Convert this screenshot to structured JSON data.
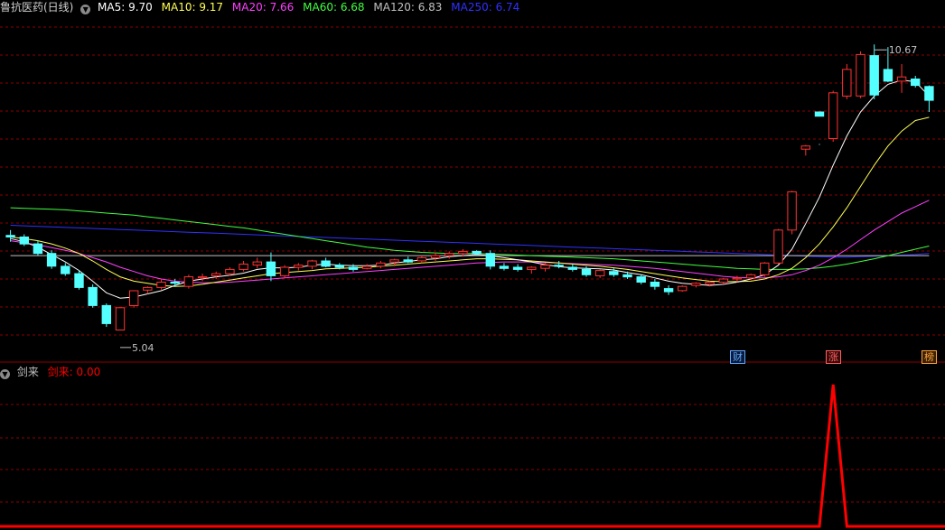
{
  "header": {
    "stock_name": "鲁抗医药(日线)",
    "ma": [
      {
        "label": "MA5: 9.70",
        "color": "#ffffff"
      },
      {
        "label": "MA10: 9.17",
        "color": "#ffff55"
      },
      {
        "label": "MA20: 7.66",
        "color": "#ff40ff"
      },
      {
        "label": "MA60: 6.68",
        "color": "#40ff40"
      },
      {
        "label": "MA120: 6.83",
        "color": "#c0c0c0"
      },
      {
        "label": "MA250: 6.74",
        "color": "#3030ff"
      }
    ]
  },
  "indicator": {
    "name": "剑来",
    "value_label": "剑来: 0.00",
    "color": "#ff0000"
  },
  "annotations": {
    "high": "10.67",
    "low": "5.04"
  },
  "badges": [
    {
      "text": "财",
      "color": "#5fa8ff",
      "bg": "#0a1a3a",
      "day": 53
    },
    {
      "text": "涨",
      "color": "#ff6060",
      "bg": "#3a0a0a",
      "day": 60
    },
    {
      "text": "榜",
      "color": "#ffa040",
      "bg": "#3a2200",
      "day": 67
    }
  ],
  "colors": {
    "up": "#ff3232",
    "down": "#54ffff",
    "grid": "#8b0000",
    "axis": "#8b0000"
  },
  "chart_data": [
    {
      "type": "candlestick",
      "title": "",
      "candles_ohlc": [
        [
          7.08,
          7.18,
          6.96,
          7.05
        ],
        [
          7.05,
          7.1,
          6.88,
          6.92
        ],
        [
          6.92,
          6.98,
          6.7,
          6.74
        ],
        [
          6.74,
          6.8,
          6.45,
          6.5
        ],
        [
          6.5,
          6.56,
          6.32,
          6.36
        ],
        [
          6.36,
          6.42,
          6.06,
          6.1
        ],
        [
          6.1,
          6.16,
          5.72,
          5.76
        ],
        [
          5.76,
          5.8,
          5.36,
          5.42
        ],
        [
          5.3,
          5.04,
          5.04,
          5.72
        ],
        [
          5.76,
          6.05,
          5.72,
          6.04
        ],
        [
          6.05,
          6.12,
          5.98,
          6.1
        ],
        [
          6.1,
          6.26,
          6.06,
          6.2
        ],
        [
          6.2,
          6.26,
          6.12,
          6.18
        ],
        [
          6.12,
          6.34,
          6.08,
          6.3
        ],
        [
          6.28,
          6.36,
          6.22,
          6.3
        ],
        [
          6.32,
          6.4,
          6.26,
          6.36
        ],
        [
          6.36,
          6.48,
          6.32,
          6.44
        ],
        [
          6.44,
          6.6,
          6.4,
          6.54
        ],
        [
          6.52,
          6.66,
          6.46,
          6.58
        ],
        [
          6.58,
          6.76,
          6.22,
          6.32
        ],
        [
          6.32,
          6.52,
          6.28,
          6.48
        ],
        [
          6.48,
          6.56,
          6.42,
          6.52
        ],
        [
          6.5,
          6.62,
          6.44,
          6.6
        ],
        [
          6.6,
          6.66,
          6.48,
          6.5
        ],
        [
          6.52,
          6.56,
          6.44,
          6.48
        ],
        [
          6.48,
          6.54,
          6.4,
          6.44
        ],
        [
          6.46,
          6.54,
          6.44,
          6.5
        ],
        [
          6.5,
          6.6,
          6.46,
          6.56
        ],
        [
          6.58,
          6.64,
          6.5,
          6.62
        ],
        [
          6.62,
          6.68,
          6.56,
          6.58
        ],
        [
          6.6,
          6.7,
          6.56,
          6.66
        ],
        [
          6.66,
          6.76,
          6.6,
          6.7
        ],
        [
          6.7,
          6.78,
          6.64,
          6.74
        ],
        [
          6.74,
          6.82,
          6.68,
          6.78
        ],
        [
          6.78,
          6.8,
          6.7,
          6.74
        ],
        [
          6.74,
          6.8,
          6.44,
          6.5
        ],
        [
          6.5,
          6.56,
          6.42,
          6.46
        ],
        [
          6.48,
          6.54,
          6.4,
          6.44
        ],
        [
          6.44,
          6.5,
          6.36,
          6.48
        ],
        [
          6.46,
          6.56,
          6.4,
          6.52
        ],
        [
          6.52,
          6.6,
          6.46,
          6.5
        ],
        [
          6.48,
          6.54,
          6.4,
          6.44
        ],
        [
          6.44,
          6.5,
          6.3,
          6.34
        ],
        [
          6.32,
          6.44,
          6.28,
          6.42
        ],
        [
          6.4,
          6.46,
          6.3,
          6.34
        ],
        [
          6.34,
          6.4,
          6.26,
          6.3
        ],
        [
          6.3,
          6.34,
          6.16,
          6.2
        ],
        [
          6.2,
          6.26,
          6.06,
          6.12
        ],
        [
          6.08,
          6.14,
          5.96,
          6.02
        ],
        [
          6.04,
          6.14,
          6.02,
          6.12
        ],
        [
          6.14,
          6.2,
          6.1,
          6.18
        ],
        [
          6.16,
          6.22,
          6.12,
          6.2
        ],
        [
          6.2,
          6.28,
          6.16,
          6.26
        ],
        [
          6.26,
          6.32,
          6.2,
          6.28
        ],
        [
          6.28,
          6.36,
          6.24,
          6.34
        ],
        [
          6.34,
          6.58,
          6.3,
          6.56
        ],
        [
          6.56,
          7.2,
          6.54,
          7.18
        ],
        [
          7.18,
          7.92,
          7.1,
          7.9
        ],
        [
          8.7,
          8.78,
          8.58,
          8.76
        ],
        [
          9.4,
          8.78,
          8.8,
          9.32
        ],
        [
          8.9,
          9.8,
          8.84,
          9.76
        ],
        [
          9.7,
          10.3,
          9.64,
          10.2
        ],
        [
          9.7,
          10.54,
          9.66,
          10.48
        ],
        [
          10.46,
          10.67,
          9.64,
          9.72
        ],
        [
          10.2,
          10.62,
          9.96,
          9.98
        ],
        [
          9.98,
          10.3,
          9.76,
          10.06
        ],
        [
          10.02,
          10.08,
          9.86,
          9.9
        ],
        [
          9.88,
          9.9,
          9.4,
          9.62
        ]
      ],
      "ma5": [
        7.02,
        6.96,
        6.86,
        6.72,
        6.58,
        6.42,
        6.22,
        6.0,
        5.9,
        5.92,
        5.98,
        6.04,
        6.14,
        6.22,
        6.26,
        6.3,
        6.33,
        6.37,
        6.44,
        6.47,
        6.47,
        6.48,
        6.52,
        6.54,
        6.52,
        6.51,
        6.51,
        6.52,
        6.56,
        6.59,
        6.62,
        6.64,
        6.68,
        6.7,
        6.72,
        6.7,
        6.66,
        6.62,
        6.58,
        6.53,
        6.49,
        6.47,
        6.46,
        6.45,
        6.43,
        6.38,
        6.34,
        6.28,
        6.22,
        6.18,
        6.16,
        6.14,
        6.16,
        6.2,
        6.26,
        6.34,
        6.52,
        6.82,
        7.3,
        7.8,
        8.4,
        8.95,
        9.4,
        9.7,
        9.92,
        10.0,
        9.97,
        9.7
      ],
      "ma10": [
        7.05,
        7.02,
        6.98,
        6.92,
        6.84,
        6.74,
        6.6,
        6.44,
        6.3,
        6.22,
        6.18,
        6.14,
        6.12,
        6.13,
        6.16,
        6.2,
        6.24,
        6.28,
        6.32,
        6.36,
        6.38,
        6.4,
        6.42,
        6.45,
        6.46,
        6.47,
        6.48,
        6.5,
        6.52,
        6.54,
        6.56,
        6.58,
        6.6,
        6.62,
        6.64,
        6.64,
        6.63,
        6.62,
        6.6,
        6.58,
        6.56,
        6.54,
        6.52,
        6.5,
        6.47,
        6.44,
        6.4,
        6.36,
        6.32,
        6.28,
        6.25,
        6.22,
        6.21,
        6.21,
        6.22,
        6.26,
        6.34,
        6.46,
        6.66,
        6.92,
        7.24,
        7.6,
        8.0,
        8.4,
        8.76,
        9.04,
        9.24,
        9.3
      ],
      "ma20": [
        6.98,
        6.94,
        6.9,
        6.85,
        6.8,
        6.74,
        6.66,
        6.58,
        6.48,
        6.4,
        6.32,
        6.26,
        6.22,
        6.2,
        6.19,
        6.19,
        6.2,
        6.22,
        6.24,
        6.26,
        6.28,
        6.3,
        6.32,
        6.34,
        6.36,
        6.38,
        6.4,
        6.42,
        6.44,
        6.46,
        6.48,
        6.5,
        6.52,
        6.54,
        6.56,
        6.57,
        6.58,
        6.58,
        6.58,
        6.57,
        6.56,
        6.55,
        6.54,
        6.53,
        6.52,
        6.5,
        6.48,
        6.46,
        6.43,
        6.4,
        6.37,
        6.34,
        6.31,
        6.29,
        6.28,
        6.28,
        6.3,
        6.34,
        6.42,
        6.52,
        6.66,
        6.82,
        7.0,
        7.18,
        7.34,
        7.5,
        7.62,
        7.74
      ],
      "ma60": [
        7.6,
        7.59,
        7.58,
        7.57,
        7.56,
        7.54,
        7.52,
        7.5,
        7.48,
        7.46,
        7.43,
        7.4,
        7.37,
        7.34,
        7.31,
        7.28,
        7.25,
        7.22,
        7.18,
        7.14,
        7.1,
        7.06,
        7.02,
        6.98,
        6.94,
        6.9,
        6.86,
        6.83,
        6.8,
        6.78,
        6.76,
        6.75,
        6.74,
        6.74,
        6.74,
        6.73,
        6.72,
        6.71,
        6.7,
        6.69,
        6.68,
        6.67,
        6.66,
        6.65,
        6.64,
        6.62,
        6.6,
        6.58,
        6.56,
        6.54,
        6.52,
        6.5,
        6.48,
        6.46,
        6.45,
        6.44,
        6.44,
        6.44,
        6.45,
        6.47,
        6.5,
        6.54,
        6.59,
        6.64,
        6.7,
        6.76,
        6.82,
        6.88
      ],
      "ma120": [
        6.7,
        6.7,
        6.7,
        6.7,
        6.7,
        6.7,
        6.7,
        6.7,
        6.7,
        6.7,
        6.7,
        6.7,
        6.7,
        6.7,
        6.7,
        6.7,
        6.7,
        6.7,
        6.7,
        6.7,
        6.7,
        6.7,
        6.7,
        6.7,
        6.7,
        6.7,
        6.7,
        6.7,
        6.7,
        6.7,
        6.7,
        6.7,
        6.7,
        6.7,
        6.7,
        6.7,
        6.7,
        6.7,
        6.7,
        6.7,
        6.7,
        6.7,
        6.7,
        6.7,
        6.7,
        6.7,
        6.7,
        6.7,
        6.7,
        6.7,
        6.7,
        6.7,
        6.7,
        6.7,
        6.7,
        6.7,
        6.7,
        6.7,
        6.7,
        6.7,
        6.7,
        6.7,
        6.7,
        6.7,
        6.7,
        6.7,
        6.7,
        6.7
      ],
      "ma250": [
        7.27,
        7.26,
        7.25,
        7.24,
        7.23,
        7.22,
        7.21,
        7.2,
        7.19,
        7.18,
        7.17,
        7.16,
        7.15,
        7.14,
        7.13,
        7.12,
        7.11,
        7.1,
        7.09,
        7.08,
        7.07,
        7.06,
        7.05,
        7.04,
        7.03,
        7.02,
        7.01,
        7.0,
        6.99,
        6.98,
        6.97,
        6.96,
        6.95,
        6.94,
        6.93,
        6.92,
        6.91,
        6.9,
        6.89,
        6.88,
        6.87,
        6.86,
        6.85,
        6.84,
        6.83,
        6.82,
        6.81,
        6.8,
        6.79,
        6.78,
        6.77,
        6.76,
        6.75,
        6.74,
        6.73,
        6.72,
        6.71,
        6.7,
        6.69,
        6.68,
        6.67,
        6.67,
        6.68,
        6.69,
        6.7,
        6.71,
        6.72,
        6.74
      ],
      "ylim": [
        4.8,
        11.2
      ]
    },
    {
      "type": "line",
      "title": "",
      "values": [
        0,
        0,
        0,
        0,
        0,
        0,
        0,
        0,
        0,
        0,
        0,
        0,
        0,
        0,
        0,
        0,
        0,
        0,
        0,
        0,
        0,
        0,
        0,
        0,
        0,
        0,
        0,
        0,
        0,
        0,
        0,
        0,
        0,
        0,
        0,
        0,
        0,
        0,
        0,
        0,
        0,
        0,
        0,
        0,
        0,
        0,
        0,
        0,
        0,
        0,
        0,
        0,
        0,
        0,
        0,
        0,
        0,
        0,
        0,
        0,
        1,
        0,
        0,
        0,
        0,
        0,
        0,
        0
      ],
      "ylim": [
        0,
        1.05
      ]
    }
  ]
}
